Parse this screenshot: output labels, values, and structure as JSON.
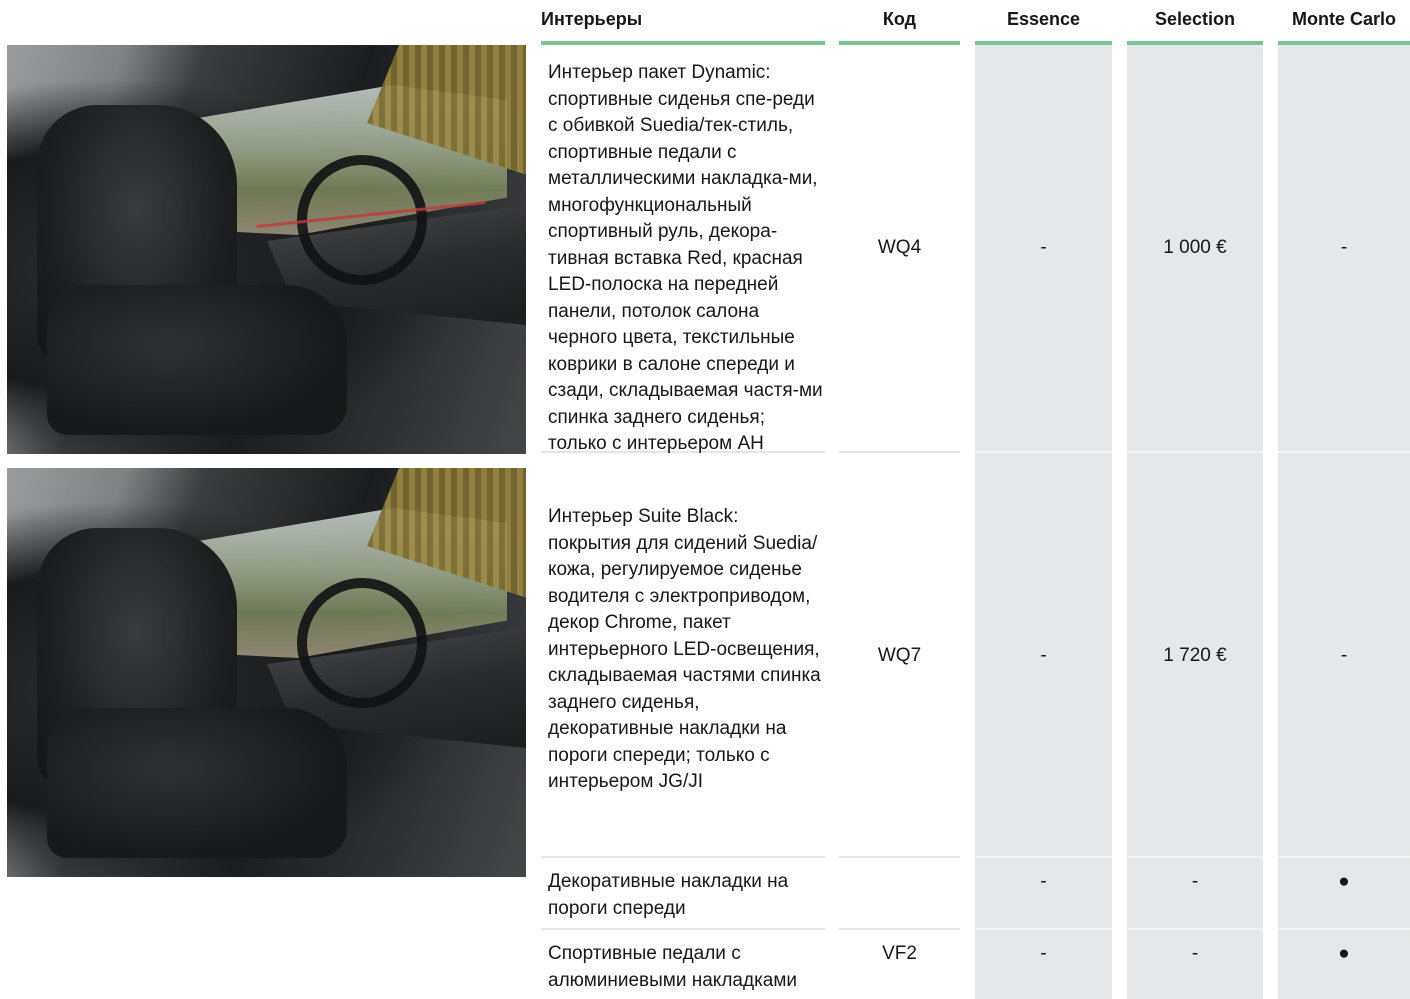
{
  "headers": {
    "interiors": "Интерьеры",
    "code": "Код",
    "essence": "Essence",
    "selection": "Selection",
    "monte_carlo": "Monte Carlo"
  },
  "photos": [
    {
      "alt": "Интерьер пакет Dynamic"
    },
    {
      "alt": "Интерьер Suite Black"
    }
  ],
  "rows": [
    {
      "description": "Интерьер пакет Dynamic: спортивные сиденья спе-реди с обивкой Suedia/тек-стиль, спортивные педали с металлическими накладка-ми, многофункциональный спортивный руль, декора-тивная вставка Red, красная LED-полоска на передней панели, потолок салона черного цвета, текстильные коврики в салоне спереди и сзади, складываемая частя-ми спинка заднего сиденья; только с интерьером AH",
      "code": "WQ4",
      "essence": "-",
      "selection": "1 000 €",
      "monte_carlo": "-"
    },
    {
      "description": "Интерьер Suite Black: покрытия для сидений Suedia/кожа, регулируемое сиденье водителя с электроприводом, декор Chrome, пакет интерьерного LED-освещения, складываемая частями спинка заднего сиденья, декоративные накладки на пороги спереди; только с интерьером JG/JI",
      "code": "WQ7",
      "essence": "-",
      "selection": "1 720 €",
      "monte_carlo": "-"
    },
    {
      "description": "Декоративные накладки на пороги спереди",
      "code": "",
      "essence": "-",
      "selection": "-",
      "monte_carlo": "●"
    },
    {
      "description": "Спортивные педали с алюминиевыми накладками",
      "code": "VF2",
      "essence": "-",
      "selection": "-",
      "monte_carlo": "●"
    }
  ],
  "colors": {
    "header_rule": "#78c594",
    "column_shade": "#e6e7e8",
    "row_divider": "#e4e5e6",
    "text": "#161718"
  }
}
